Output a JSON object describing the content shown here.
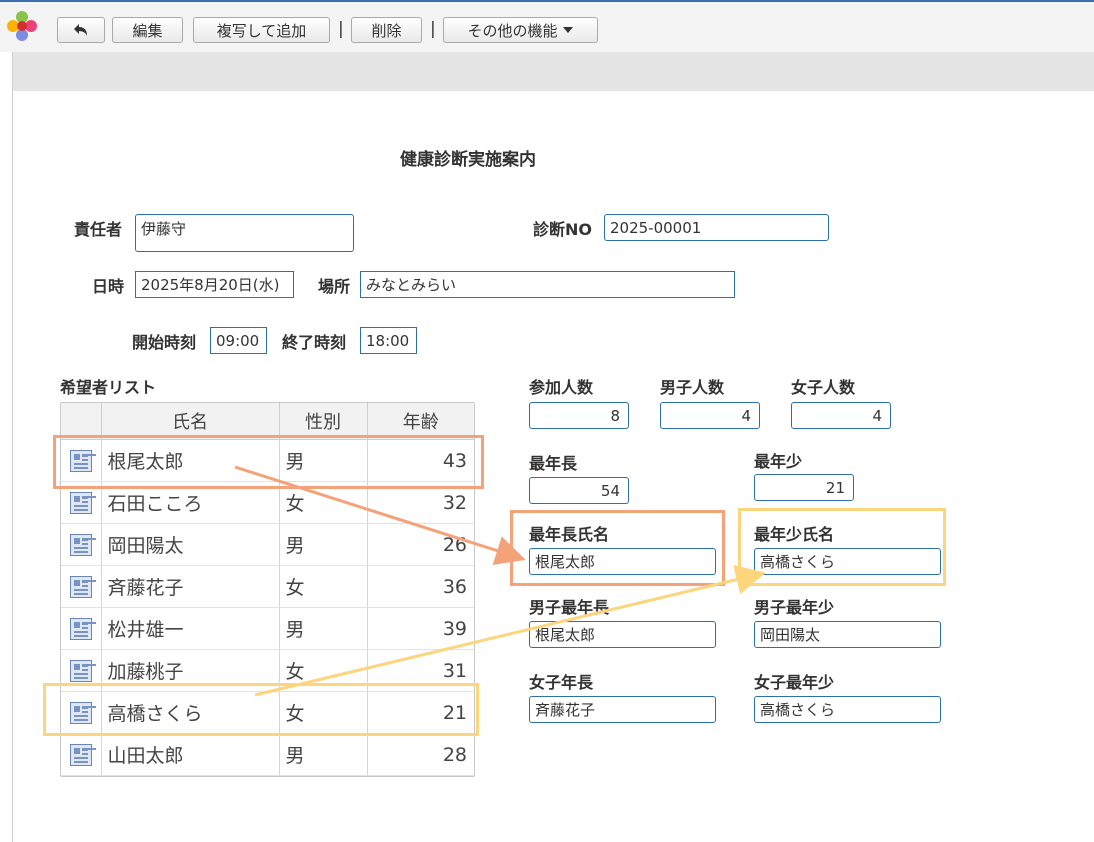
{
  "toolbar": {
    "back_label": "",
    "edit_label": "編集",
    "copy_label": "複写して追加",
    "delete_label": "削除",
    "more_label": "その他の機能"
  },
  "form": {
    "title": "健康診断実施案内",
    "responsible_label": "責任者",
    "responsible_value": "伊藤守",
    "diag_no_label": "診断NO",
    "diag_no_value": "2025-00001",
    "date_label": "日時",
    "date_value": "2025年8月20日(水)",
    "place_label": "場所",
    "place_value": "みなとみらい",
    "start_label": "開始時刻",
    "start_value": "09:00",
    "end_label": "終了時刻",
    "end_value": "18:00"
  },
  "list": {
    "title": "希望者リスト",
    "columns": [
      "氏名",
      "性別",
      "年齢"
    ],
    "rows": [
      {
        "name": "根尾太郎",
        "gender": "男",
        "age": "43"
      },
      {
        "name": "石田こころ",
        "gender": "女",
        "age": "32"
      },
      {
        "name": "岡田陽太",
        "gender": "男",
        "age": "26"
      },
      {
        "name": "斉藤花子",
        "gender": "女",
        "age": "36"
      },
      {
        "name": "松井雄一",
        "gender": "男",
        "age": "39"
      },
      {
        "name": "加藤桃子",
        "gender": "女",
        "age": "31"
      },
      {
        "name": "高橋さくら",
        "gender": "女",
        "age": "21"
      },
      {
        "name": "山田太郎",
        "gender": "男",
        "age": "28"
      }
    ]
  },
  "stats": {
    "participants_label": "参加人数",
    "participants_value": "8",
    "male_count_label": "男子人数",
    "male_count_value": "4",
    "female_count_label": "女子人数",
    "female_count_value": "4",
    "oldest_label": "最年長",
    "oldest_value": "54",
    "youngest_label": "最年少",
    "youngest_value": "21",
    "oldest_name_label": "最年長氏名",
    "oldest_name_value": "根尾太郎",
    "youngest_name_label": "最年少氏名",
    "youngest_name_value": "高橋さくら",
    "male_oldest_label": "男子最年長",
    "male_oldest_value": "根尾太郎",
    "male_youngest_label": "男子最年少",
    "male_youngest_value": "岡田陽太",
    "female_oldest_label": "女子年長",
    "female_oldest_value": "斉藤花子",
    "female_youngest_label": "女子最年少",
    "female_youngest_value": "高橋さくら"
  },
  "colors": {
    "accent_border": "#2d6fa6",
    "highlight_orange": "#f3a27a",
    "highlight_yellow": "#fcd57c"
  }
}
